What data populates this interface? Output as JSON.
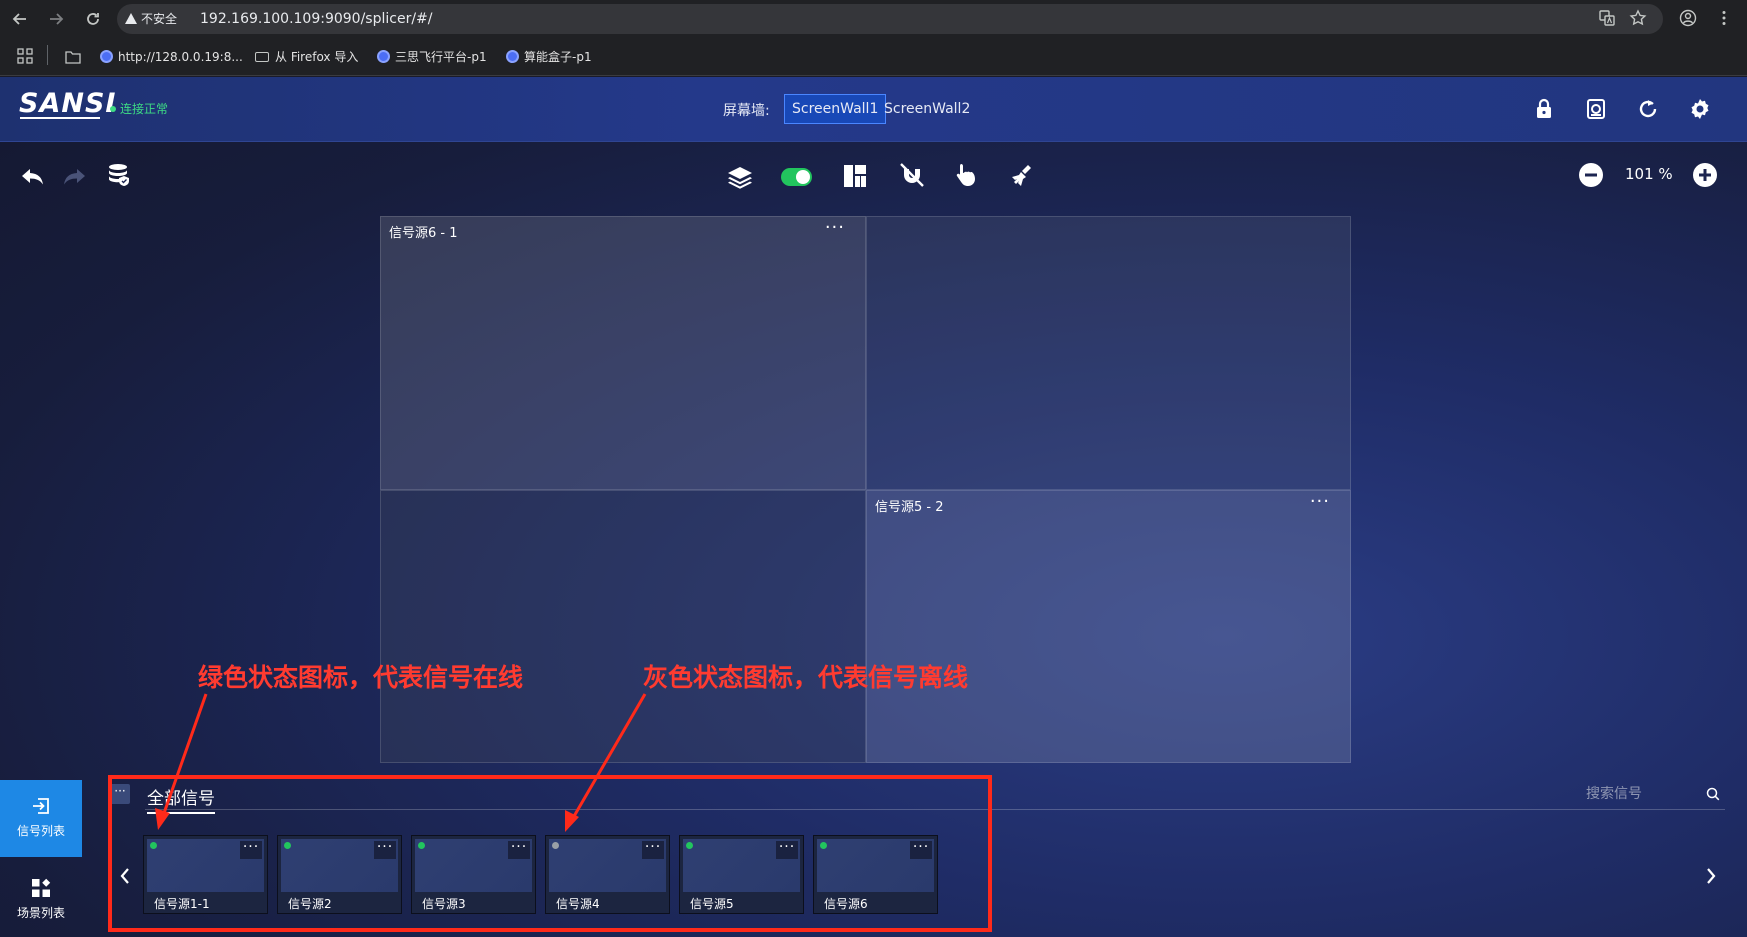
{
  "browser": {
    "insecure_label": "不安全",
    "url": "192.169.100.109:9090/splicer/#/",
    "bookmarks": [
      {
        "label": "http://128.0.0.19:8...",
        "icon": "globe-icon"
      },
      {
        "label": "从 Firefox 导入",
        "icon": "folder-icon"
      },
      {
        "label": "三思飞行平台-p1",
        "icon": "globe-icon"
      },
      {
        "label": "算能盒子-p1",
        "icon": "globe-icon"
      }
    ]
  },
  "header": {
    "logo": "SANSI",
    "connection_status": "连接正常",
    "wall_label": "屏幕墙:",
    "walls": [
      {
        "label": "ScreenWall1",
        "active": true
      },
      {
        "label": "ScreenWall2",
        "active": false
      }
    ]
  },
  "toolbar": {
    "zoom": "101 %"
  },
  "screen_wall": {
    "cells": [
      {
        "title": "信号源6 - 1",
        "has_menu": true
      },
      {
        "title": "",
        "has_menu": false
      },
      {
        "title": "",
        "has_menu": false
      },
      {
        "title": "信号源5 - 2",
        "has_menu": true
      }
    ],
    "menu_glyph": "···"
  },
  "sidebar": {
    "signal_list": "信号列表",
    "scene_list": "场景列表"
  },
  "signal_panel": {
    "title": "全部信号",
    "collapse_glyph": "···",
    "search_placeholder": "搜索信号",
    "cards": [
      {
        "label": "信号源1-1",
        "status": "online"
      },
      {
        "label": "信号源2",
        "status": "online"
      },
      {
        "label": "信号源3",
        "status": "online"
      },
      {
        "label": "信号源4",
        "status": "offline"
      },
      {
        "label": "信号源5",
        "status": "online"
      },
      {
        "label": "信号源6",
        "status": "online"
      }
    ],
    "card_menu_glyph": "···"
  },
  "annotations": {
    "online_note": "绿色状态图标，代表信号在线",
    "offline_note": "灰色状态图标，代表信号离线"
  },
  "colors": {
    "online": "#22c55e",
    "offline": "#9aa0a6",
    "accent": "#1e88e5",
    "annotation": "#ff2a1a"
  }
}
